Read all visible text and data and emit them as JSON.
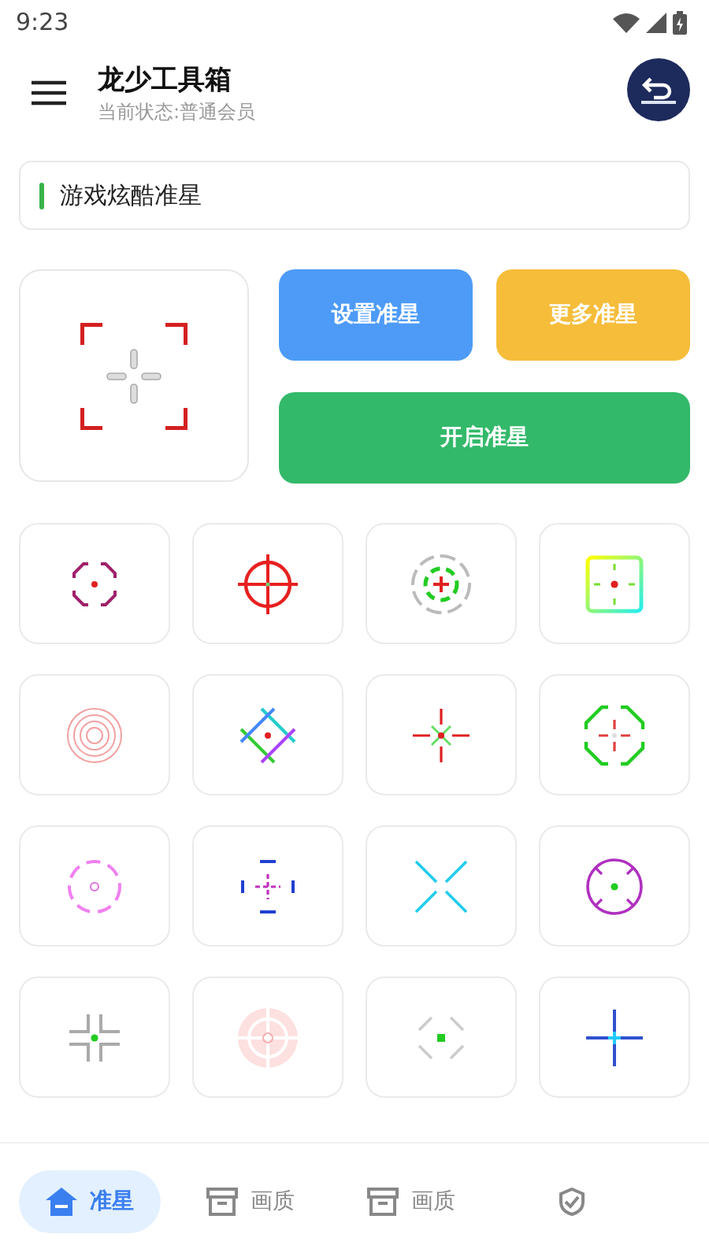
{
  "status_bar": {
    "time": "9:23"
  },
  "header": {
    "title": "龙少工具箱",
    "subtitle": "当前状态:普通会员"
  },
  "section": {
    "title": "游戏炫酷准星"
  },
  "actions": [
    {
      "label": "设置准星",
      "kind": "blue"
    },
    {
      "label": "更多准星",
      "kind": "yellow"
    },
    {
      "label": "开启准星",
      "kind": "green"
    }
  ],
  "crosshairs": [
    {
      "kind": "octagon"
    },
    {
      "kind": "scope"
    },
    {
      "kind": "rings"
    },
    {
      "kind": "square"
    },
    {
      "kind": "ripple"
    },
    {
      "kind": "lattice"
    },
    {
      "kind": "star"
    },
    {
      "kind": "green-octagon"
    },
    {
      "kind": "pink-circle"
    },
    {
      "kind": "brackets"
    },
    {
      "kind": "x"
    },
    {
      "kind": "purple-circle"
    },
    {
      "kind": "corners"
    },
    {
      "kind": "glow"
    },
    {
      "kind": "diamond"
    },
    {
      "kind": "cross"
    }
  ],
  "nav": [
    {
      "label": "准星",
      "kind": "home",
      "selected": true
    },
    {
      "label": "画质",
      "kind": "box",
      "selected": false
    },
    {
      "label": "画质",
      "kind": "box",
      "selected": false
    },
    {
      "kind": "shield",
      "selected": false
    }
  ]
}
